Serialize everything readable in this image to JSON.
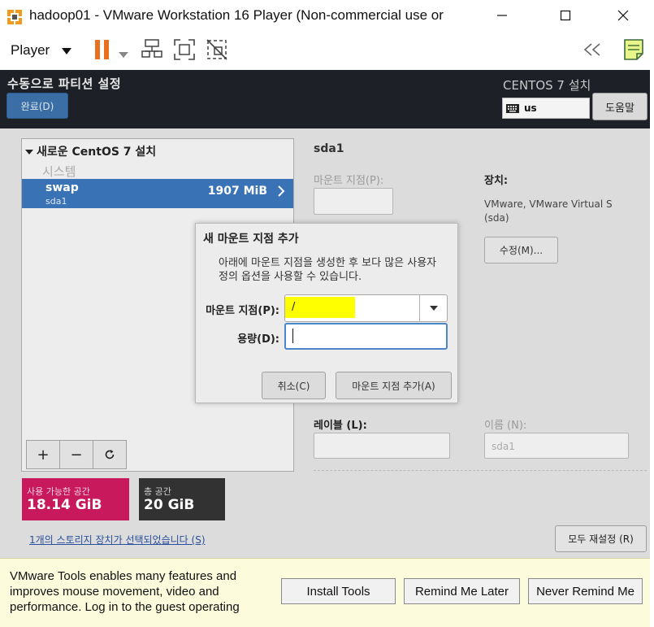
{
  "window": {
    "title": "hadoop01 - VMware Workstation 16 Player (Non-commercial use or"
  },
  "toolbar": {
    "player_menu": "Player",
    "icons": [
      "pause-icon",
      "dropdown-icon",
      "send-ctrl-alt-del-icon",
      "fullscreen-icon",
      "unity-icon",
      "collapse-icon",
      "notes-icon"
    ],
    "accent": "#e8711f"
  },
  "installer": {
    "page_title": "수동으로 파티션 설정",
    "done_button": "완료(D)",
    "distro_title": "CENTOS 7 설치",
    "keyboard_layout": "us",
    "help_button": "도움말",
    "left_panel": {
      "group_title": "새로운 CentOS 7 설치",
      "section_label": "시스템",
      "selected_item": {
        "name": "swap",
        "device": "sda1",
        "size": "1907 MiB"
      },
      "add_button": "+",
      "remove_button": "−",
      "refresh_button": "⟳"
    },
    "available_space": {
      "label": "사용 가능한 공간",
      "value": "18.14 GiB"
    },
    "total_space": {
      "label": "총 공간",
      "value": "20 GiB"
    },
    "storage_link": "1개의 스토리지 장치가 선택되었습니다 (S)",
    "reset_button": "모두 재설정 (R)",
    "right_panel": {
      "heading": "sda1",
      "mount_point_label": "마운트 지점(P):",
      "device_label": "장치:",
      "device_value": "VMware, VMware Virtual S",
      "device_sub": "(sda)",
      "modify_button": "수정(M)...",
      "label_label": "레이블 (L):",
      "name_label": "이름 (N):",
      "name_value": "sda1",
      "frag_1": "용량(D):",
      "frag_2": ")",
      "frag_3": ")"
    },
    "accent": "#3a73b5"
  },
  "dialog": {
    "title": "새 마운트 지점 추가",
    "description": "아래에 마운트 지점을 생성한 후 보다 많은 사용자 정의 옵션을 사용할 수 있습니다.",
    "mount_point_label": "마운트 지점(P):",
    "mount_point_value": "/",
    "capacity_label": "용량(D):",
    "capacity_value": "",
    "cancel_button": "취소(C)",
    "add_button": "마운트 지점 추가(A)"
  },
  "tools_bar": {
    "message": "VMware Tools enables many features and improves mouse movement, video and performance. Log in to the guest operating",
    "install_button": "Install Tools",
    "remind_button": "Remind Me Later",
    "never_button": "Never Remind Me"
  }
}
